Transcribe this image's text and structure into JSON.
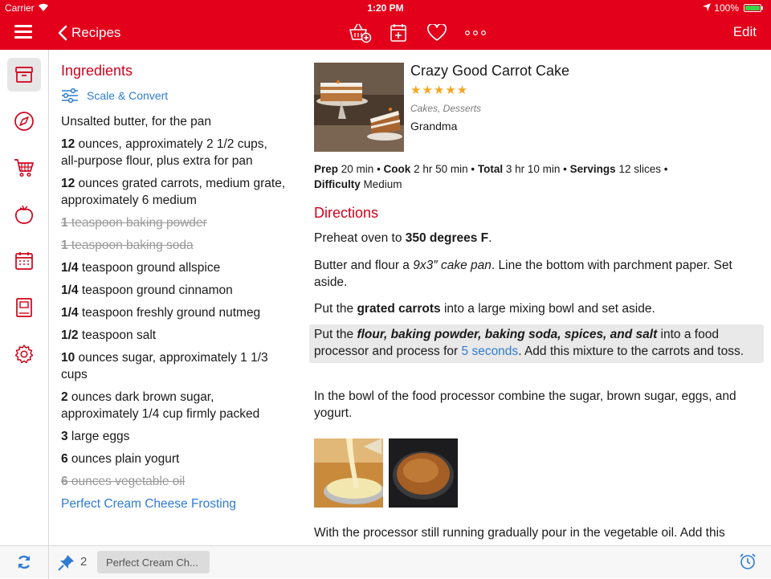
{
  "status": {
    "carrier": "Carrier",
    "time": "1:20 PM",
    "battery": "100%"
  },
  "nav": {
    "back_label": "Recipes",
    "edit_label": "Edit",
    "icons": [
      "add-to-groceries-icon",
      "add-to-calendar-icon",
      "favorite-icon",
      "more-icon"
    ],
    "accent": "#e2001a"
  },
  "rail": [
    "recipes-box-icon",
    "browse-compass-icon",
    "groceries-cart-icon",
    "pantry-apple-icon",
    "calendar-icon",
    "cookbook-icon",
    "settings-gear-icon"
  ],
  "ingredients": {
    "title": "Ingredients",
    "scale_label": "Scale & Convert",
    "items": [
      {
        "qty": "",
        "text": "Unsalted butter, for the pan",
        "struck": false
      },
      {
        "qty": "12",
        "text": " ounces, approximately 2 1/2 cups, all-purpose flour, plus extra for pan",
        "struck": false
      },
      {
        "qty": "12",
        "text": " ounces grated carrots, medium grate, approximately 6 medium",
        "struck": false
      },
      {
        "qty": "1",
        "text": " teaspoon baking powder",
        "struck": true
      },
      {
        "qty": "1",
        "text": " teaspoon baking soda",
        "struck": true
      },
      {
        "qty": "1/4",
        "text": " teaspoon ground allspice",
        "struck": false
      },
      {
        "qty": "1/4",
        "text": " teaspoon ground cinnamon",
        "struck": false
      },
      {
        "qty": "1/4",
        "text": " teaspoon freshly ground nutmeg",
        "struck": false
      },
      {
        "qty": "1/2",
        "text": " teaspoon salt",
        "struck": false
      },
      {
        "qty": "10",
        "text": " ounces sugar, approximately 1 1/3 cups",
        "struck": false
      },
      {
        "qty": "2",
        "text": " ounces dark brown sugar, approximately 1/4 cup firmly packed",
        "struck": false
      },
      {
        "qty": "3",
        "text": " large eggs",
        "struck": false
      },
      {
        "qty": "6",
        "text": " ounces plain yogurt",
        "struck": false
      },
      {
        "qty": "6",
        "text": " ounces vegetable oil",
        "struck": true
      }
    ],
    "link": "Perfect Cream Cheese Frosting"
  },
  "recipe": {
    "title": "Crazy Good Carrot Cake",
    "stars": "★★★★★",
    "categories": "Cakes, Desserts",
    "source": "Grandma",
    "meta": {
      "prep_label": "Prep",
      "prep": "20 min",
      "cook_label": "Cook",
      "cook": "2 hr 50 min",
      "total_label": "Total",
      "total": "3 hr 10 min",
      "servings_label": "Servings",
      "servings": "12 slices",
      "difficulty_label": "Difficulty",
      "difficulty": "Medium"
    },
    "directions_title": "Directions",
    "steps": {
      "s1_a": "Preheat oven to ",
      "s1_b": "350 degrees F",
      "s1_c": ".",
      "s2_a": "Butter and flour a ",
      "s2_b": "9x3″ cake pan",
      "s2_c": ". Line the bottom with parchment paper. Set aside.",
      "s3_a": "Put the ",
      "s3_b": "grated carrots",
      "s3_c": " into a large mixing bowl and set aside.",
      "s4_a": "Put the ",
      "s4_b": "flour, baking powder, baking soda, spices, and salt",
      "s4_c": " into a food processor and process for ",
      "s4_timer": "5 seconds",
      "s4_d": ". Add this mixture to the carrots and toss.",
      "s5": "In the bowl of the food processor combine the sugar, brown sugar, eggs, and yogurt.",
      "s6": "With the processor still running gradually pour in the vegetable oil. Add this"
    }
  },
  "bottom": {
    "pin_count": "2",
    "chip_label": "Perfect Cream Ch..."
  }
}
